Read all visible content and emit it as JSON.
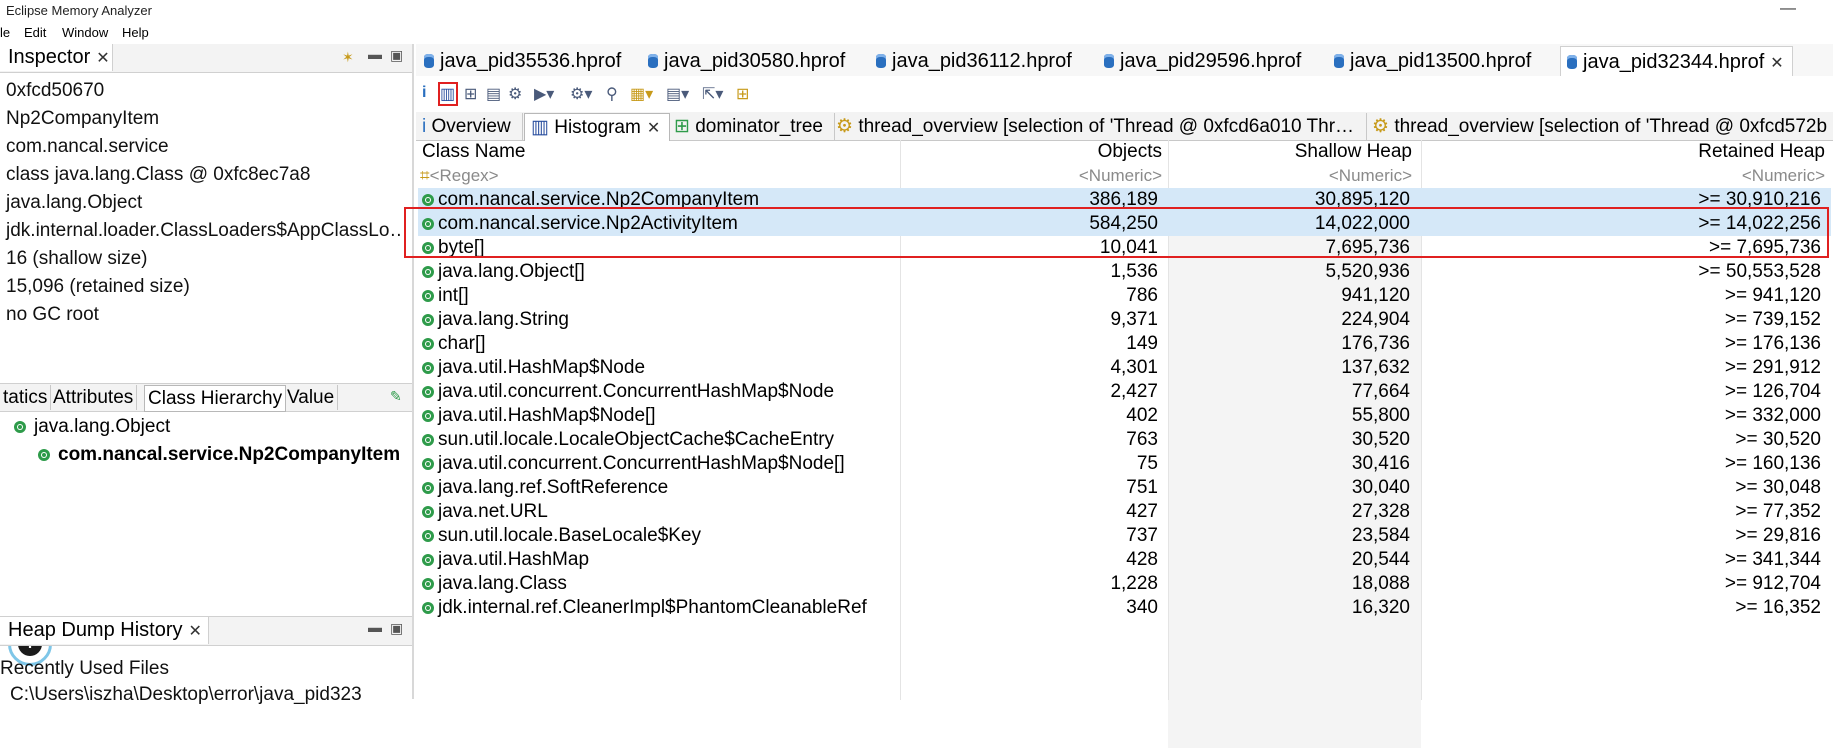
{
  "window": {
    "title": "Eclipse Memory Analyzer",
    "min_glyph": "—",
    "max_glyph": "☐"
  },
  "menu": [
    "le",
    "Edit",
    "Window",
    "Help"
  ],
  "inspector": {
    "tab_label": "Inspector",
    "close_glyph": "✕",
    "rows": [
      "0xfcd50670",
      "Np2CompanyItem",
      "com.nancal.service",
      "class java.lang.Class @ 0xfc8ec7a8",
      "java.lang.Object",
      "jdk.internal.loader.ClassLoaders$AppClassLo…",
      "16 (shallow size)",
      "15,096 (retained size)",
      "no GC root"
    ],
    "subtabs": [
      "tatics",
      "Attributes",
      "Class Hierarchy",
      "Value"
    ],
    "active_subtab": "Class Hierarchy",
    "hierarchy": [
      "java.lang.Object",
      "com.nancal.service.Np2CompanyItem"
    ]
  },
  "heap_history": {
    "tab_label": "Heap Dump History",
    "recent_label": "Recently Used Files",
    "recent_path": "C:\\Users\\iszha\\Desktop\\error\\java_pid323"
  },
  "file_tabs": [
    "java_pid35536.hprof",
    "java_pid30580.hprof",
    "java_pid36112.hprof",
    "java_pid29596.hprof",
    "java_pid13500.hprof",
    "java_pid32344.hprof"
  ],
  "active_file_tab": "java_pid32344.hprof",
  "view_tabs": [
    "Overview",
    "Histogram",
    "dominator_tree",
    "thread_overview  [selection of 'Thread @ 0xfcd6a010  Thr…",
    "thread_overview  [selection of 'Thread @ 0xfcd572b"
  ],
  "active_view_tab": "Histogram",
  "table": {
    "headers": [
      "Class Name",
      "Objects",
      "Shallow Heap",
      "Retained Heap"
    ],
    "filters": [
      "<Regex>",
      "<Numeric>",
      "<Numeric>",
      "<Numeric>"
    ],
    "rows": [
      {
        "name": "com.nancal.service.Np2CompanyItem",
        "objects": "386,189",
        "shallow": "30,895,120",
        "retained": ">= 30,910,216"
      },
      {
        "name": "com.nancal.service.Np2ActivityItem",
        "objects": "584,250",
        "shallow": "14,022,000",
        "retained": ">= 14,022,256"
      },
      {
        "name": "byte[]",
        "objects": "10,041",
        "shallow": "7,695,736",
        "retained": ">= 7,695,736"
      },
      {
        "name": "java.lang.Object[]",
        "objects": "1,536",
        "shallow": "5,520,936",
        "retained": ">= 50,553,528"
      },
      {
        "name": "int[]",
        "objects": "786",
        "shallow": "941,120",
        "retained": ">= 941,120"
      },
      {
        "name": "java.lang.String",
        "objects": "9,371",
        "shallow": "224,904",
        "retained": ">= 739,152"
      },
      {
        "name": "char[]",
        "objects": "149",
        "shallow": "176,736",
        "retained": ">= 176,136"
      },
      {
        "name": "java.util.HashMap$Node",
        "objects": "4,301",
        "shallow": "137,632",
        "retained": ">= 291,912"
      },
      {
        "name": "java.util.concurrent.ConcurrentHashMap$Node",
        "objects": "2,427",
        "shallow": "77,664",
        "retained": ">= 126,704"
      },
      {
        "name": "java.util.HashMap$Node[]",
        "objects": "402",
        "shallow": "55,800",
        "retained": ">= 332,000"
      },
      {
        "name": "sun.util.locale.LocaleObjectCache$CacheEntry",
        "objects": "763",
        "shallow": "30,520",
        "retained": ">= 30,520"
      },
      {
        "name": "java.util.concurrent.ConcurrentHashMap$Node[]",
        "objects": "75",
        "shallow": "30,416",
        "retained": ">= 160,136"
      },
      {
        "name": "java.lang.ref.SoftReference",
        "objects": "751",
        "shallow": "30,040",
        "retained": ">= 30,048"
      },
      {
        "name": "java.net.URL",
        "objects": "427",
        "shallow": "27,328",
        "retained": ">= 77,352"
      },
      {
        "name": "sun.util.locale.BaseLocale$Key",
        "objects": "737",
        "shallow": "23,584",
        "retained": ">= 29,816"
      },
      {
        "name": "java.util.HashMap",
        "objects": "428",
        "shallow": "20,544",
        "retained": ">= 341,344"
      },
      {
        "name": "java.lang.Class",
        "objects": "1,228",
        "shallow": "18,088",
        "retained": ">= 912,704"
      },
      {
        "name": "jdk.internal.ref.CleanerImpl$PhantomCleanableRef",
        "objects": "340",
        "shallow": "16,320",
        "retained": ">= 16,352"
      }
    ],
    "selected_rows": 2
  },
  "colors": {
    "selection": "#d5e8f8",
    "highlight_border": "#e02020",
    "class_icon": "#2e9b4a"
  }
}
